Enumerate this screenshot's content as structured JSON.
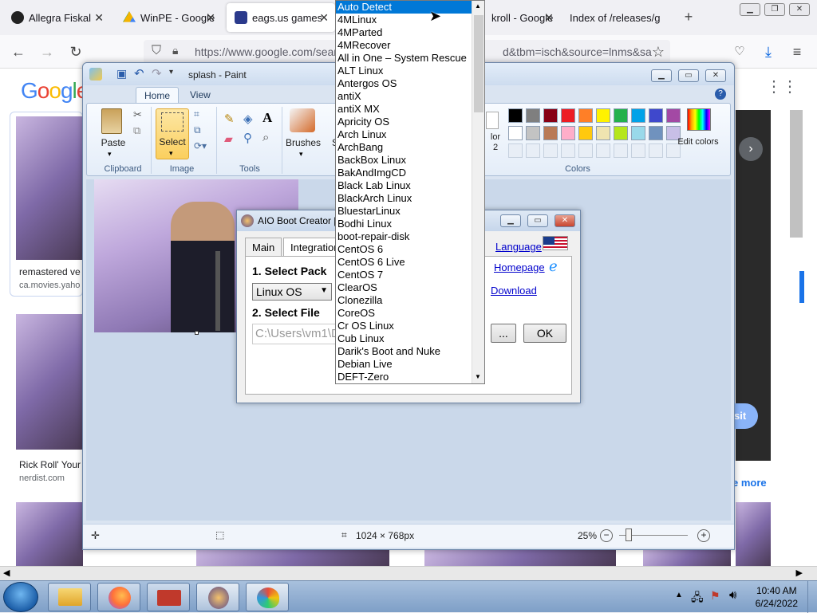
{
  "browser": {
    "tabs": [
      {
        "label": "Allegra Fiskal"
      },
      {
        "label": "WinPE - Google"
      },
      {
        "label": "eags.us games"
      },
      {
        "label": "kroll - Google"
      },
      {
        "label": "Index of /releases/g"
      }
    ],
    "new_tab": "+",
    "url": "https://www.google.com/sear",
    "url_tail": "d&tbm=isch&source=lnms&sa"
  },
  "google": {
    "logo": "Google",
    "results": [
      {
        "caption": "remastered ve",
        "source": "ca.movies.yaho"
      },
      {
        "caption": "Rick Roll' Your",
        "source": "nerdist.com"
      }
    ],
    "visit_label": "sit",
    "see_more": "e more"
  },
  "paint": {
    "title": "splash - Paint",
    "tabs": [
      "Home",
      "View"
    ],
    "groups": {
      "clipboard": "Clipboard",
      "image": "Image",
      "tools": "Tools",
      "colors": "Colors"
    },
    "buttons": {
      "paste": "Paste",
      "select": "Select",
      "brushes": "Brushes",
      "shapes": "S",
      "color2": "lor\n2",
      "edit_colors": "Edit colors"
    },
    "palette_row1": [
      "#000000",
      "#7f7f7f",
      "#880015",
      "#ed1c24",
      "#ff7f27",
      "#fff200",
      "#22b14c",
      "#00a2e8",
      "#3f48cc",
      "#a349a4"
    ],
    "palette_row2": [
      "#ffffff",
      "#c3c3c3",
      "#b97a57",
      "#ffaec9",
      "#ffc90e",
      "#efe4b0",
      "#b5e61d",
      "#99d9ea",
      "#7092be",
      "#c8bfe7"
    ],
    "status": {
      "dimensions": "1024 × 768px",
      "zoom": "25%"
    }
  },
  "aio": {
    "title": "AIO Boot Creator [",
    "tabs": [
      "Main",
      "Integration"
    ],
    "select_pack_label": "1. Select Pack",
    "pack_value": "Linux OS",
    "select_file_label": "2. Select File",
    "file_path": "C:\\Users\\vm1\\D",
    "language": "Language",
    "homepage": "Homepage",
    "download": "Download",
    "browse_btn": "...",
    "ok_btn": "OK"
  },
  "dropdown": {
    "items": [
      "Auto Detect",
      "4MLinux",
      "4MParted",
      "4MRecover",
      "All in One – System Rescue",
      "ALT Linux",
      "Antergos OS",
      "antiX",
      "antiX MX",
      "Apricity OS",
      "Arch Linux",
      "ArchBang",
      "BackBox Linux",
      "BakAndImgCD",
      "Black Lab Linux",
      "BlackArch Linux",
      "BluestarLinux",
      "Bodhi Linux",
      "boot-repair-disk",
      "CentOS 6",
      "CentOS 6 Live",
      "CentOS 7",
      "ClearOS",
      "Clonezilla",
      "CoreOS",
      "Cr OS Linux",
      "Cub Linux",
      "Darik's Boot and Nuke",
      "Debian Live",
      "DEFT-Zero"
    ],
    "selected_index": 0
  },
  "taskbar": {
    "time": "10:40 AM",
    "date": "6/24/2022"
  }
}
